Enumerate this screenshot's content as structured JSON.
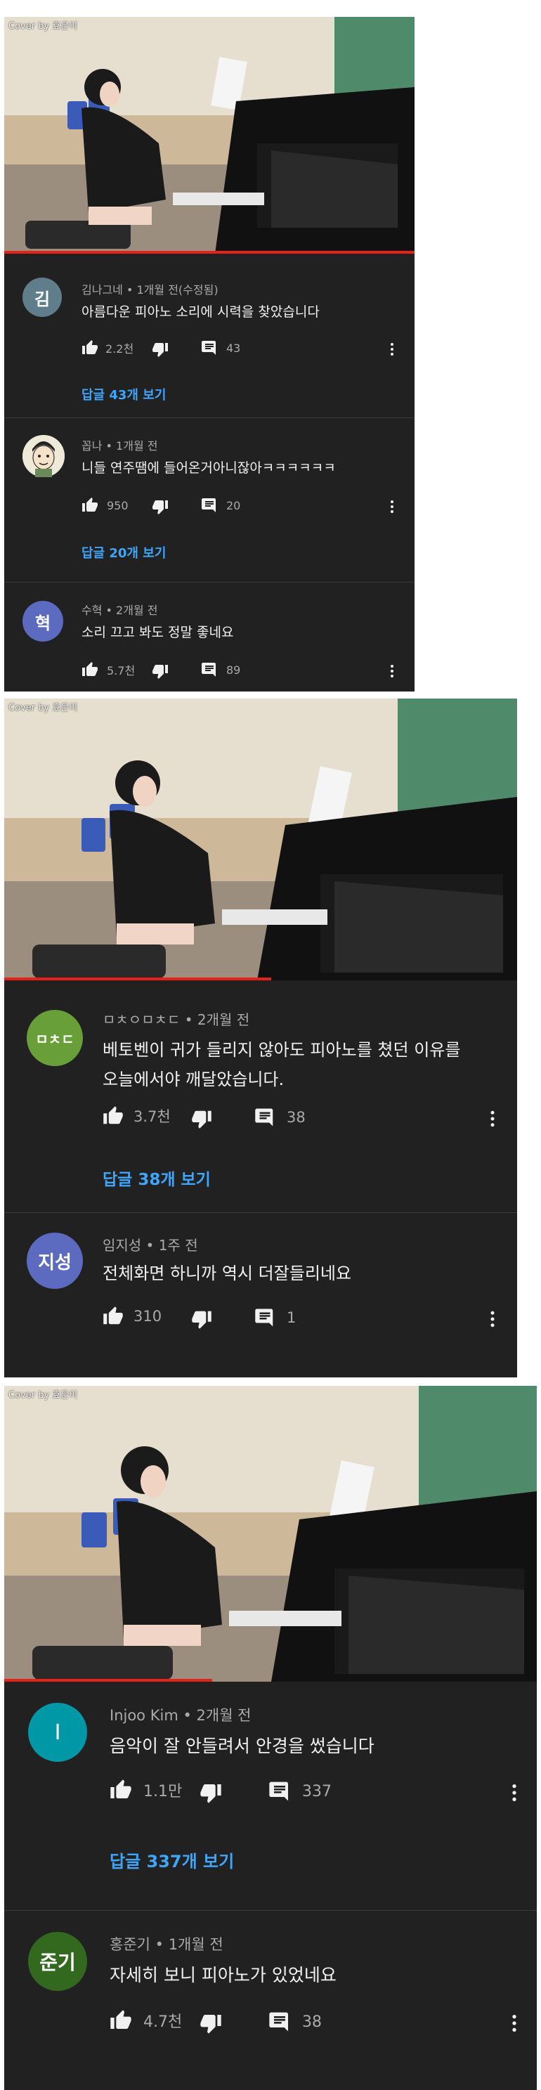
{
  "video": {
    "watermark": "Cover by 효은이"
  },
  "panels": [
    {
      "comments": [
        {
          "initial": "김",
          "color": "#607d8b",
          "author": "김나그네 • 1개월 전(수정됨)",
          "text": "아름다운 피아노 소리에 시력을 찾았습니다",
          "likes": "2.2천",
          "replies": "43",
          "reply_link": "답글 43개 보기"
        },
        {
          "initial": "",
          "color": "#e8e4d8",
          "author": "꼽나 • 1개월 전",
          "text": "니들 연주땜에 들어온거아니잖아ㅋㅋㅋㅋㅋㅋ",
          "likes": "950",
          "replies": "20",
          "reply_link": "답글 20개 보기"
        },
        {
          "initial": "혁",
          "color": "#5c6bc0",
          "author": "수혁 • 2개월 전",
          "text": "소리 끄고 봐도 정말 좋네요",
          "likes": "5.7천",
          "replies": "89",
          "reply_link": ""
        }
      ]
    },
    {
      "comments": [
        {
          "initial": "ㅁㅊㄷ",
          "color": "#689f38",
          "author": "ㅁㅊㅇㅁㅊㄷ • 2개월 전",
          "text": "베토벤이 귀가 들리지 않아도 피아노를 쳤던 이유를\n오늘에서야 깨달았습니다.",
          "likes": "3.7천",
          "replies": "38",
          "reply_link": "답글 38개 보기"
        },
        {
          "initial": "지성",
          "color": "#5c6bc0",
          "author": "임지성 • 1주 전",
          "text": "전체화면 하니까 역시 더잘들리네요",
          "likes": "310",
          "replies": "1",
          "reply_link": ""
        }
      ]
    },
    {
      "comments": [
        {
          "initial": "I",
          "color": "#0097a7",
          "author": "Injoo Kim • 2개월 전",
          "text": "음악이 잘 안들려서 안경을 썼습니다",
          "likes": "1.1만",
          "replies": "337",
          "reply_link": "답글 337개 보기"
        },
        {
          "initial": "준기",
          "color": "#33691e",
          "author": "홍준기 • 1개월 전",
          "text": "자세히 보니 피아노가 있었네요",
          "likes": "4.7천",
          "replies": "38",
          "reply_link": ""
        }
      ]
    }
  ],
  "colors": {
    "background": "#212121",
    "text": "#f1f1f1",
    "meta": "#aaaaaa",
    "link": "#3ea6ff",
    "progress": "#e62117"
  },
  "icons": [
    "thumb-up-icon",
    "thumb-down-icon",
    "comment-icon",
    "more-vert-icon"
  ]
}
